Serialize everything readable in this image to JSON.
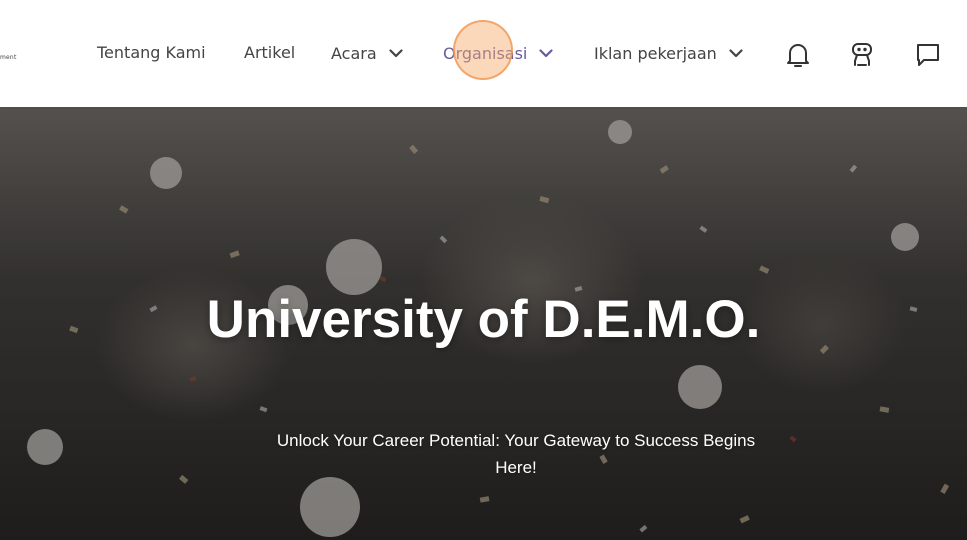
{
  "nav": {
    "logo_fragment": "ment",
    "items": [
      {
        "label": "Tentang Kami",
        "has_dropdown": false
      },
      {
        "label": "Artikel",
        "has_dropdown": false
      },
      {
        "label": "Acara",
        "has_dropdown": true
      },
      {
        "label": "Organisasi",
        "has_dropdown": true,
        "active": true
      },
      {
        "label": "Iklan pekerjaan",
        "has_dropdown": true
      }
    ],
    "icons": [
      "bell-icon",
      "robot-icon",
      "chat-icon"
    ],
    "accent_color": "#6a5a9c"
  },
  "hero": {
    "title": "University of D.E.M.O.",
    "subtitle": "Unlock Your Career Potential: Your Gateway to Success Begins Here!"
  }
}
